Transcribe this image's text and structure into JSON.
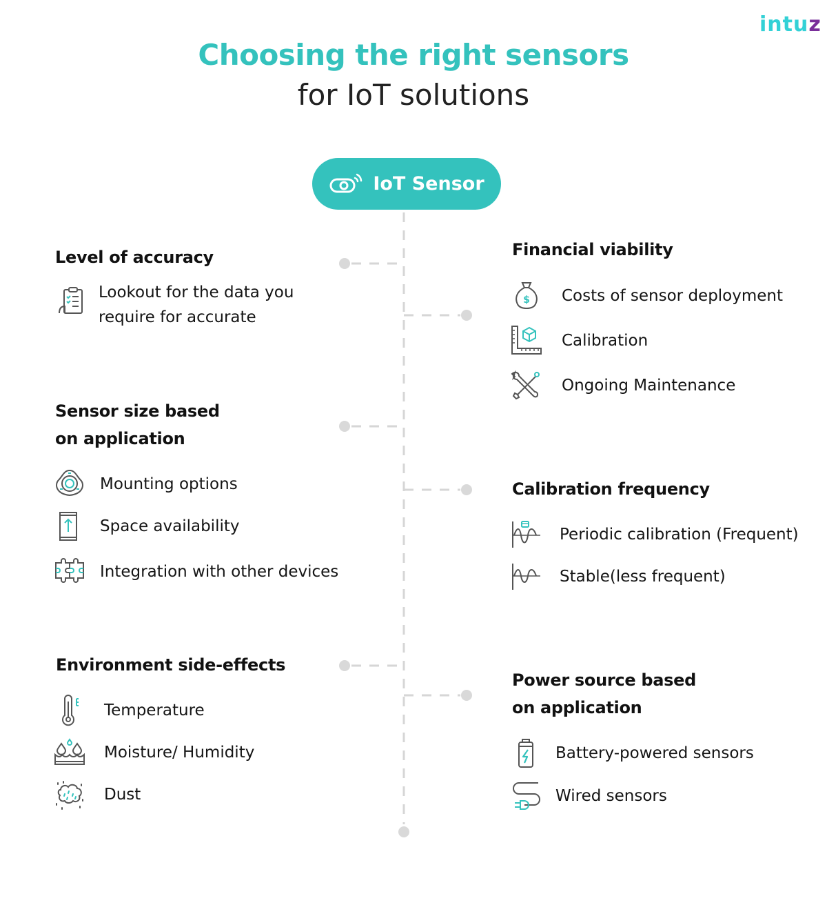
{
  "brand": {
    "logo_text": "intu",
    "logo_last": "z",
    "accent": "#34c2bd"
  },
  "header": {
    "title": "Choosing the right sensors",
    "subtitle": "for IoT solutions"
  },
  "center_node": {
    "label": "IoT Sensor",
    "icon": "iot-sensor-icon"
  },
  "sections": {
    "accuracy": {
      "title": "Level of accuracy",
      "items": [
        {
          "icon": "checklist-icon",
          "label": "Lookout for the data you require for accurate"
        }
      ]
    },
    "financial": {
      "title": "Financial viability",
      "items": [
        {
          "icon": "money-bag-icon",
          "label": "Costs of sensor deployment"
        },
        {
          "icon": "calibration-ruler-icon",
          "label": "Calibration"
        },
        {
          "icon": "tools-icon",
          "label": "Ongoing Maintenance"
        }
      ]
    },
    "size": {
      "title_line1": "Sensor size based",
      "title_line2": "on application",
      "items": [
        {
          "icon": "mount-icon",
          "label": "Mounting options"
        },
        {
          "icon": "space-icon",
          "label": "Space availability"
        },
        {
          "icon": "puzzle-icon",
          "label": "Integration with other devices"
        }
      ]
    },
    "calibration_frequency": {
      "title": "Calibration frequency",
      "items": [
        {
          "icon": "periodic-wave-icon",
          "label": "Periodic calibration (Frequent)"
        },
        {
          "icon": "stable-wave-icon",
          "label": "Stable(less frequent)"
        }
      ]
    },
    "environment": {
      "title": "Environment side-effects",
      "items": [
        {
          "icon": "thermometer-icon",
          "label": "Temperature"
        },
        {
          "icon": "humidity-icon",
          "label": "Moisture/ Humidity"
        },
        {
          "icon": "dust-icon",
          "label": "Dust"
        }
      ]
    },
    "power": {
      "title_line1": "Power source based",
      "title_line2": "on application",
      "items": [
        {
          "icon": "battery-icon",
          "label": "Battery-powered sensors"
        },
        {
          "icon": "plug-icon",
          "label": "Wired sensors"
        }
      ]
    }
  }
}
